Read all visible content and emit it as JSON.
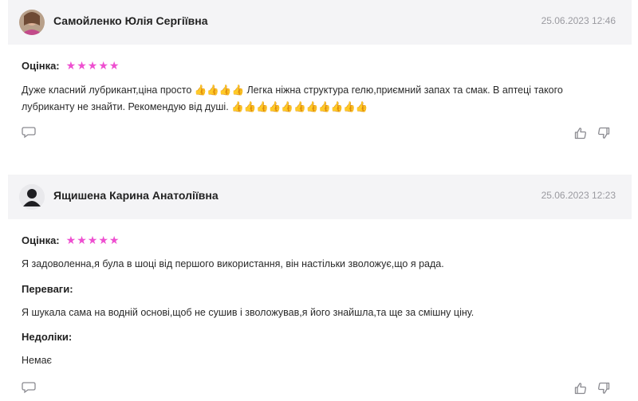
{
  "reviews": [
    {
      "author": "Самойленко Юлія Сергіївна",
      "date": "25.06.2023 12:46",
      "rating_label": "Оцінка:",
      "rating": 5,
      "text": "Дуже класний лубрикант,ціна просто 👍👍👍👍 Легка ніжна структура гелю,приємний запах та смак. В аптеці такого лубриканту не знайти. Рекомендую від душі. 👍👍👍👍👍👍👍👍👍👍👍"
    },
    {
      "author": "Ящишена Карина Анатоліївна",
      "date": "25.06.2023 12:23",
      "rating_label": "Оцінка:",
      "rating": 5,
      "text": "Я задоволенна,я була в шоці від першого використання, він настільки зволожує,що я рада.",
      "pros_label": "Переваги:",
      "pros": "Я шукала сама на водній основі,щоб не сушив і зволожував,я його знайшла,та ще за смішну ціну.",
      "cons_label": "Недоліки:",
      "cons": "Немає"
    }
  ],
  "icons": [
    "comment-icon",
    "like-icon",
    "dislike-icon",
    "star-icon",
    "avatar"
  ],
  "colors": {
    "star": "#ee4fd0",
    "header_bg": "#f4f4f6",
    "muted": "#9a9aa0"
  }
}
